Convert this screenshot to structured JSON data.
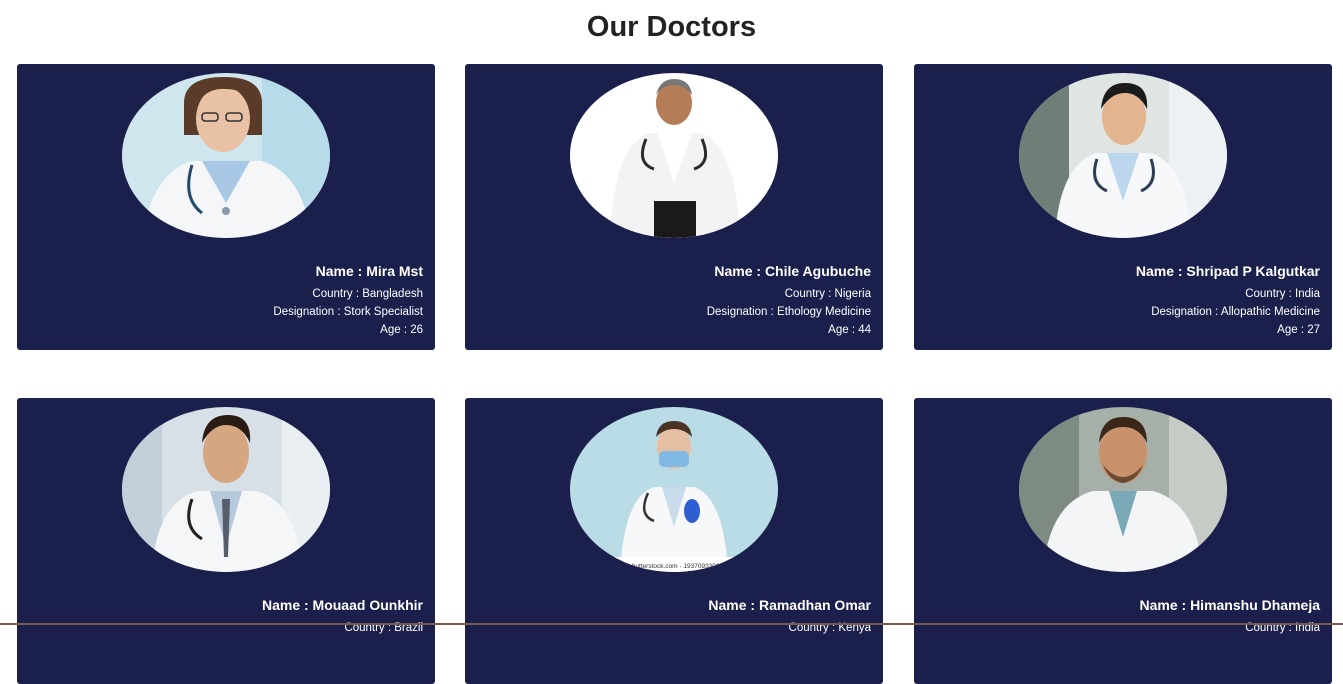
{
  "page": {
    "title": "Our Doctors"
  },
  "doctors": [
    {
      "name": "Name : Mira Mst",
      "country": "Country : Bangladesh",
      "designation": "Designation : Stork Specialist",
      "age": "Age : 26",
      "photo": "doctor-photo-woman"
    },
    {
      "name": "Name : Chile Agubuche",
      "country": "Country : Nigeria",
      "designation": "Designation : Ethology Medicine",
      "age": "Age : 44",
      "photo": "doctor-photo-man"
    },
    {
      "name": "Name : Shripad P Kalgutkar",
      "country": "Country : India",
      "designation": "Designation : Allopathic Medicine",
      "age": "Age : 27",
      "photo": "doctor-photo-man"
    },
    {
      "name": "Name : Mouaad Ounkhir",
      "country": "Country : Brazil",
      "designation": "",
      "age": "",
      "photo": "doctor-photo-man"
    },
    {
      "name": "Name : Ramadhan Omar",
      "country": "Country : Kenya",
      "designation": "",
      "age": "",
      "photo": "doctor-photo-man-masked",
      "watermark": "shutterstock.com · 1937093306"
    },
    {
      "name": "Name : Himanshu Dhameja",
      "country": "Country : India",
      "designation": "",
      "age": "",
      "photo": "doctor-photo-man"
    }
  ],
  "colors": {
    "card_bg": "#1b1f4c",
    "card_text": "#ffffff",
    "title": "#222222"
  }
}
